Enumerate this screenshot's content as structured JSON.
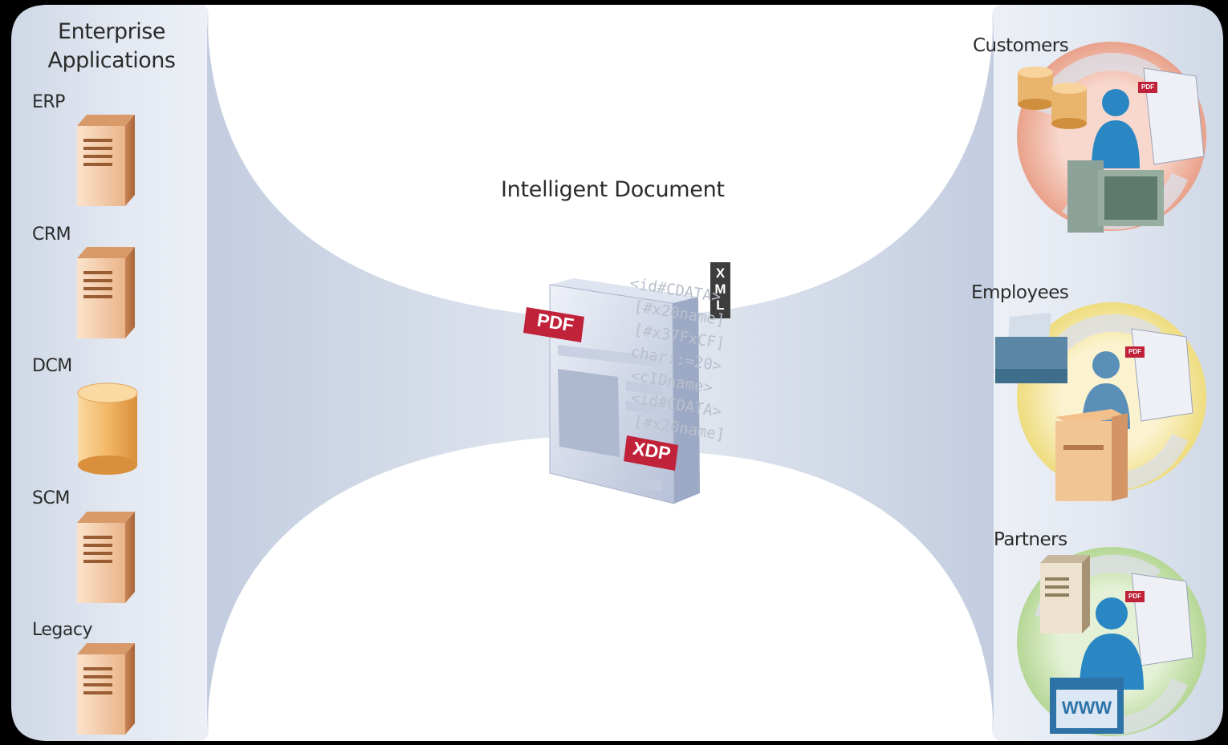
{
  "left_panel": {
    "title_line1": "Enterprise",
    "title_line2": "Applications",
    "systems": [
      {
        "label": "ERP",
        "icon": "server-icon"
      },
      {
        "label": "CRM",
        "icon": "server-icon"
      },
      {
        "label": "DCM",
        "icon": "database-icon"
      },
      {
        "label": "SCM",
        "icon": "server-icon"
      },
      {
        "label": "Legacy",
        "icon": "server-icon"
      }
    ]
  },
  "center": {
    "title": "Intelligent Document",
    "pdf_tag": "PDF",
    "xdp_tag": "XDP",
    "xml_tag": [
      "X",
      "M",
      "L"
    ],
    "code_lines": [
      "<id#CDATA>",
      "[#x20name]",
      "[#x37FxCF]",
      "char::=20>",
      "<cIDname>",
      "<id#CDATA>",
      "[#x20name]"
    ]
  },
  "right_panel": {
    "stakeholders": [
      {
        "label": "Customers",
        "color": "#e8a08a"
      },
      {
        "label": "Employees",
        "color": "#f0e28c"
      },
      {
        "label": "Partners",
        "color": "#b9d99a"
      }
    ],
    "mini_pdf": "PDF",
    "www": "WWW"
  },
  "colors": {
    "panel": "#dde4ef",
    "funnel": "#c5d0e2",
    "server": "#e8b58d",
    "accent_red": "#c0223a",
    "person": "#2a87c4"
  }
}
